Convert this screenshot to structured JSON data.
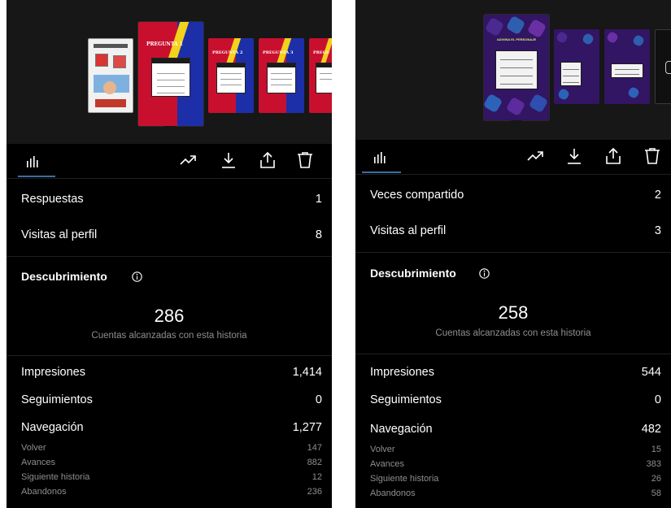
{
  "screenshots": [
    {
      "id": "left",
      "reach": {
        "count": "286",
        "caption": "Cuentas alcanzadas con esta historia"
      },
      "discovery_title": "Descubrimiento",
      "top_rows": [
        {
          "label": "Respuestas",
          "value": "1"
        },
        {
          "label": "Visitas al perfil",
          "value": "8"
        }
      ],
      "metrics": [
        {
          "label": "Impresiones",
          "value": "1,414"
        },
        {
          "label": "Seguimientos",
          "value": "0"
        },
        {
          "label": "Navegación",
          "value": "1,277"
        }
      ],
      "navigation": [
        {
          "label": "Volver",
          "value": "147"
        },
        {
          "label": "Avances",
          "value": "882"
        },
        {
          "label": "Siguiente historia",
          "value": "12"
        },
        {
          "label": "Abandonos",
          "value": "236"
        }
      ],
      "thumb_labels": [
        "PREGUNTA 1",
        "PREGUNTA 2",
        "PREGUNTA 3",
        "PREGU"
      ]
    },
    {
      "id": "right",
      "reach": {
        "count": "258",
        "caption": "Cuentas alcanzadas con esta historia"
      },
      "discovery_title": "Descubrimiento",
      "top_rows": [
        {
          "label": "Veces compartido",
          "value": "2"
        },
        {
          "label": "Visitas al perfil",
          "value": "3"
        }
      ],
      "metrics": [
        {
          "label": "Impresiones",
          "value": "544"
        },
        {
          "label": "Seguimientos",
          "value": "0"
        },
        {
          "label": "Navegación",
          "value": "482"
        }
      ],
      "navigation": [
        {
          "label": "Volver",
          "value": "15"
        },
        {
          "label": "Avances",
          "value": "383"
        },
        {
          "label": "Siguiente historia",
          "value": "26"
        },
        {
          "label": "Abandonos",
          "value": "58"
        }
      ]
    }
  ],
  "icons": {
    "tab": "bar-chart-icon",
    "actions": [
      "trending-up-icon",
      "download-icon",
      "share-icon",
      "trash-icon"
    ],
    "info": "info-icon"
  },
  "colors": {
    "background": "#000000",
    "strip": "#171717",
    "tab_accent": "#3a6ea5",
    "secondary_text": "#8e8e8e",
    "story_red": "#c8102e",
    "story_blue": "#1c2fa8",
    "story_yellow": "#f2d21b",
    "story_purple": "#321563"
  }
}
